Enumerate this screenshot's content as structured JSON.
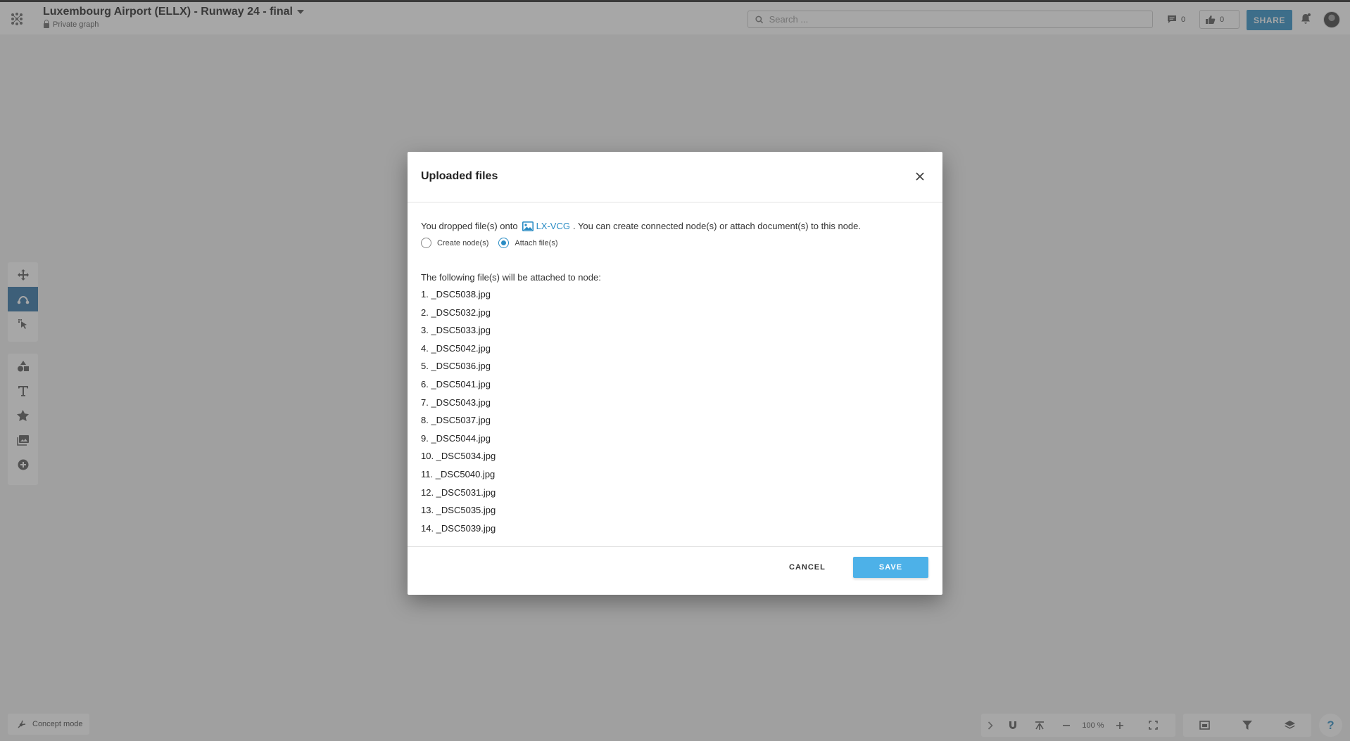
{
  "header": {
    "graph_title": "Luxembourg Airport (ELLX) - Runway 24 - final",
    "visibility": "Private graph",
    "search_placeholder": "Search ...",
    "comments_count": "0",
    "likes_count": "0",
    "share_label": "SHARE"
  },
  "left_toolbar": {
    "group_a": [
      "move-icon",
      "connect-icon",
      "select-icon"
    ],
    "group_b": [
      "shapes-icon",
      "text-icon",
      "star-icon",
      "image-icon",
      "add-circle-icon"
    ],
    "active": "connect-icon"
  },
  "bottom": {
    "concept_mode_label": "Concept mode",
    "zoom_level": "100 %"
  },
  "modal": {
    "title": "Uploaded files",
    "intro_prefix": "You dropped file(s) onto",
    "node_name": "LX-VCG",
    "intro_suffix": ". You can create connected node(s) or attach document(s) to this node.",
    "option_create": "Create node(s)",
    "option_attach": "Attach file(s)",
    "selected_option": "attach",
    "files_label": "The following file(s) will be attached to node:",
    "files": [
      "1. _DSC5038.jpg",
      "2. _DSC5032.jpg",
      "3. _DSC5033.jpg",
      "4. _DSC5042.jpg",
      "5. _DSC5036.jpg",
      "6. _DSC5041.jpg",
      "7. _DSC5043.jpg",
      "8. _DSC5037.jpg",
      "9. _DSC5044.jpg",
      "10. _DSC5034.jpg",
      "11. _DSC5040.jpg",
      "12. _DSC5031.jpg",
      "13. _DSC5035.jpg",
      "14. _DSC5039.jpg"
    ],
    "cancel_label": "CANCEL",
    "save_label": "SAVE"
  },
  "colors": {
    "accent": "#2a8cc4",
    "save_button": "#4db1e8",
    "active_tool": "#2a6ea3",
    "overlay": "#808080"
  }
}
